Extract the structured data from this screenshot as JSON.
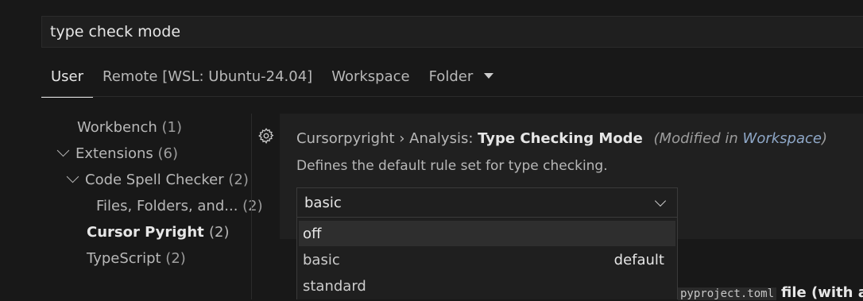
{
  "search": {
    "value": "type check mode"
  },
  "tabs": [
    {
      "label": "User"
    },
    {
      "label": "Remote [WSL: Ubuntu-24.04]"
    },
    {
      "label": "Workspace"
    },
    {
      "label": "Folder"
    }
  ],
  "tree": [
    {
      "label": "Workbench",
      "count": "(1)"
    },
    {
      "label": "Extensions",
      "count": "(6)"
    },
    {
      "label": "Code Spell Checker",
      "count": "(2)"
    },
    {
      "label": "Files, Folders, and...",
      "count": "(2)"
    },
    {
      "label": "Cursor Pyright",
      "count": "(2)"
    },
    {
      "label": "TypeScript",
      "count": "(2)"
    }
  ],
  "setting": {
    "category": "Cursorpyright › Analysis:",
    "key": "Type Checking Mode",
    "modified_prefix": "(Modified in",
    "modified_link": "Workspace",
    "modified_suffix": ")",
    "description": "Defines the default rule set for type checking.",
    "value": "basic",
    "options": [
      {
        "label": "off",
        "note": ""
      },
      {
        "label": "basic",
        "note": "default"
      },
      {
        "label": "standard",
        "note": ""
      }
    ]
  },
  "behind": {
    "code": "pyproject.toml",
    "text": "file (with a"
  },
  "icons": {
    "gear": "gear-icon",
    "dropdown": "chevron-down-icon",
    "tree": "chevron-down-icon"
  },
  "colors": {
    "background": "#181818",
    "panel": "#202020",
    "link": "#8fa8c8"
  }
}
